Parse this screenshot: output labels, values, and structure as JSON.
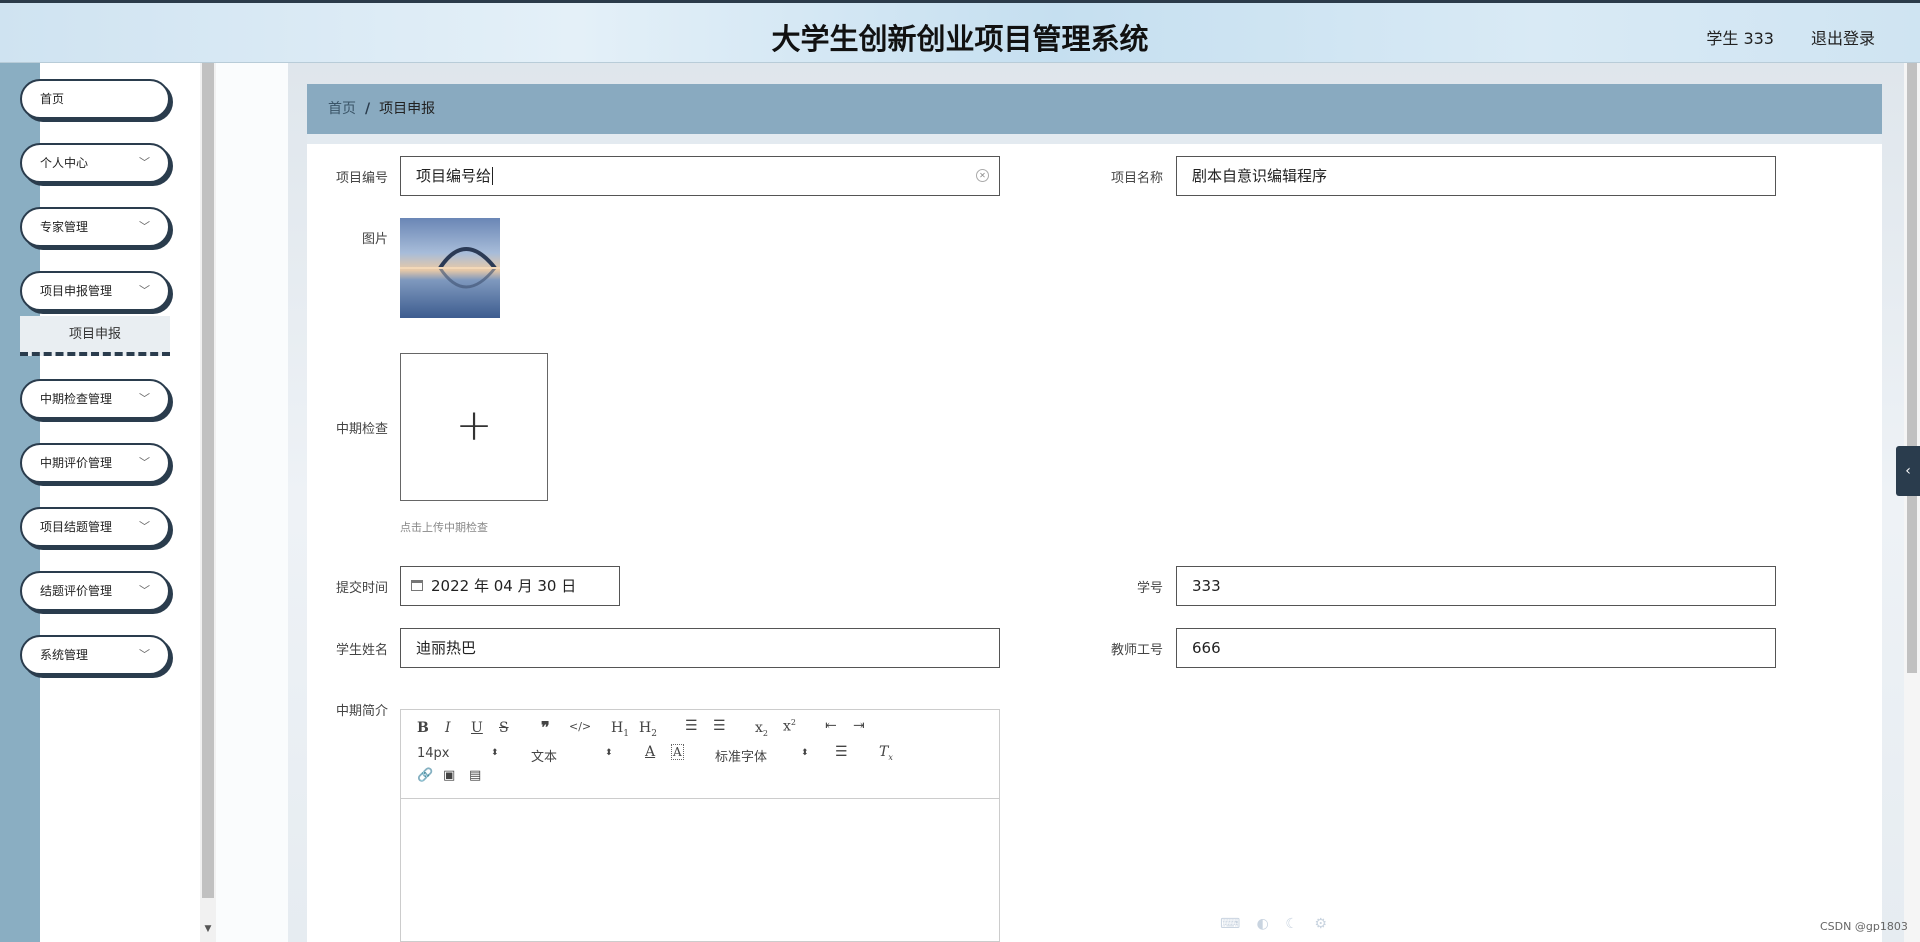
{
  "header": {
    "title": "大学生创新创业项目管理系统",
    "user": "学生 333",
    "logout": "退出登录"
  },
  "sidebar": {
    "items": [
      {
        "label": "首页",
        "has_chevron": false
      },
      {
        "label": "个人中心",
        "has_chevron": true
      },
      {
        "label": "专家管理",
        "has_chevron": true
      },
      {
        "label": "项目申报管理",
        "has_chevron": true
      },
      {
        "label": "中期检查管理",
        "has_chevron": true
      },
      {
        "label": "中期评价管理",
        "has_chevron": true
      },
      {
        "label": "项目结题管理",
        "has_chevron": true
      },
      {
        "label": "结题评价管理",
        "has_chevron": true
      },
      {
        "label": "系统管理",
        "has_chevron": true
      }
    ],
    "submenu": "项目申报"
  },
  "breadcrumb": {
    "home": "首页",
    "separator": "/",
    "current": "项目申报"
  },
  "form": {
    "project_no_label": "项目编号",
    "project_no_value": "项目编号给",
    "project_name_label": "项目名称",
    "project_name_value": "剧本自意识编辑程序",
    "image_label": "图片",
    "midterm_label": "中期检查",
    "upload_hint": "点击上传中期检查",
    "submit_time_label": "提交时间",
    "submit_time_value": "2022 年 04 月 30 日",
    "student_no_label": "学号",
    "student_no_value": "333",
    "student_name_label": "学生姓名",
    "student_name_value": "迪丽热巴",
    "teacher_no_label": "教师工号",
    "teacher_no_value": "666",
    "intro_label": "中期简介"
  },
  "editor": {
    "font_size": "14px",
    "paragraph": "文本",
    "font_family": "标准字体"
  },
  "watermark": "CSDN @gp1803"
}
